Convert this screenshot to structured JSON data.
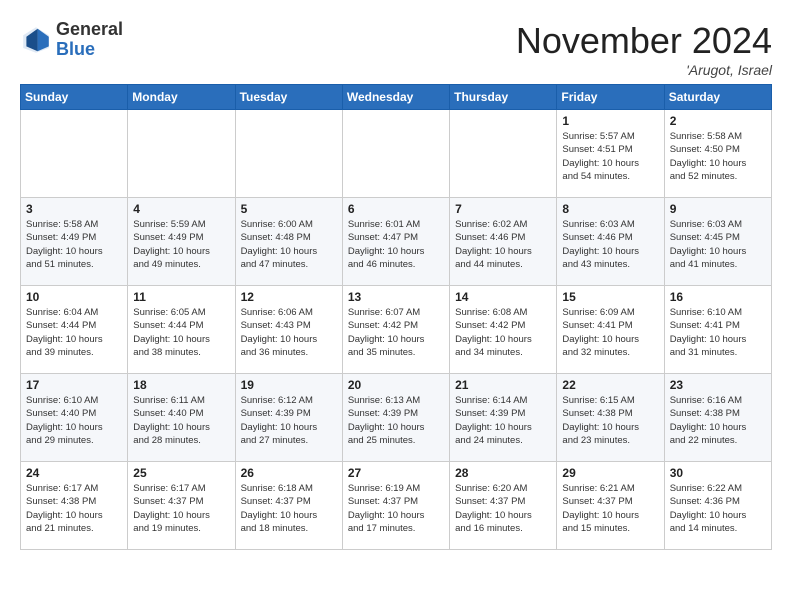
{
  "logo": {
    "general": "General",
    "blue": "Blue"
  },
  "header": {
    "month": "November 2024",
    "location": "'Arugot, Israel"
  },
  "weekdays": [
    "Sunday",
    "Monday",
    "Tuesday",
    "Wednesday",
    "Thursday",
    "Friday",
    "Saturday"
  ],
  "weeks": [
    [
      {
        "day": "",
        "info": ""
      },
      {
        "day": "",
        "info": ""
      },
      {
        "day": "",
        "info": ""
      },
      {
        "day": "",
        "info": ""
      },
      {
        "day": "",
        "info": ""
      },
      {
        "day": "1",
        "info": "Sunrise: 5:57 AM\nSunset: 4:51 PM\nDaylight: 10 hours\nand 54 minutes."
      },
      {
        "day": "2",
        "info": "Sunrise: 5:58 AM\nSunset: 4:50 PM\nDaylight: 10 hours\nand 52 minutes."
      }
    ],
    [
      {
        "day": "3",
        "info": "Sunrise: 5:58 AM\nSunset: 4:49 PM\nDaylight: 10 hours\nand 51 minutes."
      },
      {
        "day": "4",
        "info": "Sunrise: 5:59 AM\nSunset: 4:49 PM\nDaylight: 10 hours\nand 49 minutes."
      },
      {
        "day": "5",
        "info": "Sunrise: 6:00 AM\nSunset: 4:48 PM\nDaylight: 10 hours\nand 47 minutes."
      },
      {
        "day": "6",
        "info": "Sunrise: 6:01 AM\nSunset: 4:47 PM\nDaylight: 10 hours\nand 46 minutes."
      },
      {
        "day": "7",
        "info": "Sunrise: 6:02 AM\nSunset: 4:46 PM\nDaylight: 10 hours\nand 44 minutes."
      },
      {
        "day": "8",
        "info": "Sunrise: 6:03 AM\nSunset: 4:46 PM\nDaylight: 10 hours\nand 43 minutes."
      },
      {
        "day": "9",
        "info": "Sunrise: 6:03 AM\nSunset: 4:45 PM\nDaylight: 10 hours\nand 41 minutes."
      }
    ],
    [
      {
        "day": "10",
        "info": "Sunrise: 6:04 AM\nSunset: 4:44 PM\nDaylight: 10 hours\nand 39 minutes."
      },
      {
        "day": "11",
        "info": "Sunrise: 6:05 AM\nSunset: 4:44 PM\nDaylight: 10 hours\nand 38 minutes."
      },
      {
        "day": "12",
        "info": "Sunrise: 6:06 AM\nSunset: 4:43 PM\nDaylight: 10 hours\nand 36 minutes."
      },
      {
        "day": "13",
        "info": "Sunrise: 6:07 AM\nSunset: 4:42 PM\nDaylight: 10 hours\nand 35 minutes."
      },
      {
        "day": "14",
        "info": "Sunrise: 6:08 AM\nSunset: 4:42 PM\nDaylight: 10 hours\nand 34 minutes."
      },
      {
        "day": "15",
        "info": "Sunrise: 6:09 AM\nSunset: 4:41 PM\nDaylight: 10 hours\nand 32 minutes."
      },
      {
        "day": "16",
        "info": "Sunrise: 6:10 AM\nSunset: 4:41 PM\nDaylight: 10 hours\nand 31 minutes."
      }
    ],
    [
      {
        "day": "17",
        "info": "Sunrise: 6:10 AM\nSunset: 4:40 PM\nDaylight: 10 hours\nand 29 minutes."
      },
      {
        "day": "18",
        "info": "Sunrise: 6:11 AM\nSunset: 4:40 PM\nDaylight: 10 hours\nand 28 minutes."
      },
      {
        "day": "19",
        "info": "Sunrise: 6:12 AM\nSunset: 4:39 PM\nDaylight: 10 hours\nand 27 minutes."
      },
      {
        "day": "20",
        "info": "Sunrise: 6:13 AM\nSunset: 4:39 PM\nDaylight: 10 hours\nand 25 minutes."
      },
      {
        "day": "21",
        "info": "Sunrise: 6:14 AM\nSunset: 4:39 PM\nDaylight: 10 hours\nand 24 minutes."
      },
      {
        "day": "22",
        "info": "Sunrise: 6:15 AM\nSunset: 4:38 PM\nDaylight: 10 hours\nand 23 minutes."
      },
      {
        "day": "23",
        "info": "Sunrise: 6:16 AM\nSunset: 4:38 PM\nDaylight: 10 hours\nand 22 minutes."
      }
    ],
    [
      {
        "day": "24",
        "info": "Sunrise: 6:17 AM\nSunset: 4:38 PM\nDaylight: 10 hours\nand 21 minutes."
      },
      {
        "day": "25",
        "info": "Sunrise: 6:17 AM\nSunset: 4:37 PM\nDaylight: 10 hours\nand 19 minutes."
      },
      {
        "day": "26",
        "info": "Sunrise: 6:18 AM\nSunset: 4:37 PM\nDaylight: 10 hours\nand 18 minutes."
      },
      {
        "day": "27",
        "info": "Sunrise: 6:19 AM\nSunset: 4:37 PM\nDaylight: 10 hours\nand 17 minutes."
      },
      {
        "day": "28",
        "info": "Sunrise: 6:20 AM\nSunset: 4:37 PM\nDaylight: 10 hours\nand 16 minutes."
      },
      {
        "day": "29",
        "info": "Sunrise: 6:21 AM\nSunset: 4:37 PM\nDaylight: 10 hours\nand 15 minutes."
      },
      {
        "day": "30",
        "info": "Sunrise: 6:22 AM\nSunset: 4:36 PM\nDaylight: 10 hours\nand 14 minutes."
      }
    ]
  ]
}
